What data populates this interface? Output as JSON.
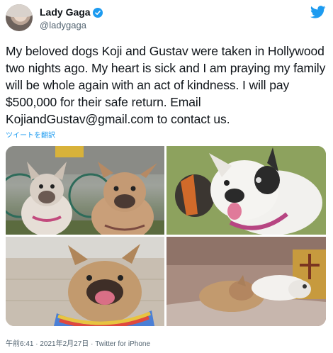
{
  "user": {
    "display_name": "Lady Gaga",
    "handle": "@ladygaga",
    "verified": true
  },
  "tweet": {
    "text": "My beloved dogs Koji and Gustav were taken in Hollywood two nights ago. My heart is sick and I am praying my family will be whole again with an act of kindness. I will pay $500,000 for their safe return. Email KojiandGustav@gmail.com to contact us.",
    "translate_label": "ツイートを翻訳"
  },
  "media": {
    "photos": [
      {
        "name": "photo-1"
      },
      {
        "name": "photo-2"
      },
      {
        "name": "photo-3"
      },
      {
        "name": "photo-4"
      }
    ]
  },
  "meta": {
    "time": "午前6:41",
    "separator1": " · ",
    "date": "2021年2月27日",
    "separator2": " · ",
    "source": "Twitter for iPhone"
  },
  "colors": {
    "accent": "#1d9bf0",
    "text": "#0f1419",
    "secondary": "#536471"
  },
  "icons": [
    "verified-badge-icon",
    "twitter-bird-icon"
  ]
}
